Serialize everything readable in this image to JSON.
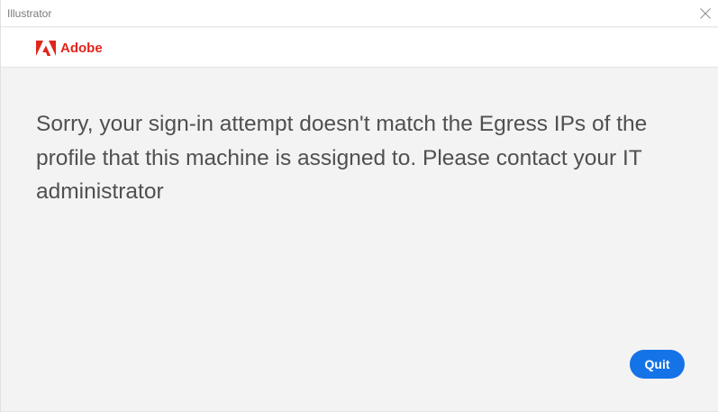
{
  "window": {
    "title": "Illustrator",
    "close_icon": "close-icon"
  },
  "brand": {
    "name": "Adobe",
    "logo_icon": "adobe-logo-icon",
    "color": "#e1251b"
  },
  "message": {
    "text": "Sorry, your sign-in attempt doesn't match the Egress IPs of the profile that this machine is assigned to. Please contact your IT administrator"
  },
  "actions": {
    "quit_label": "Quit",
    "quit_color": "#1473e6"
  }
}
